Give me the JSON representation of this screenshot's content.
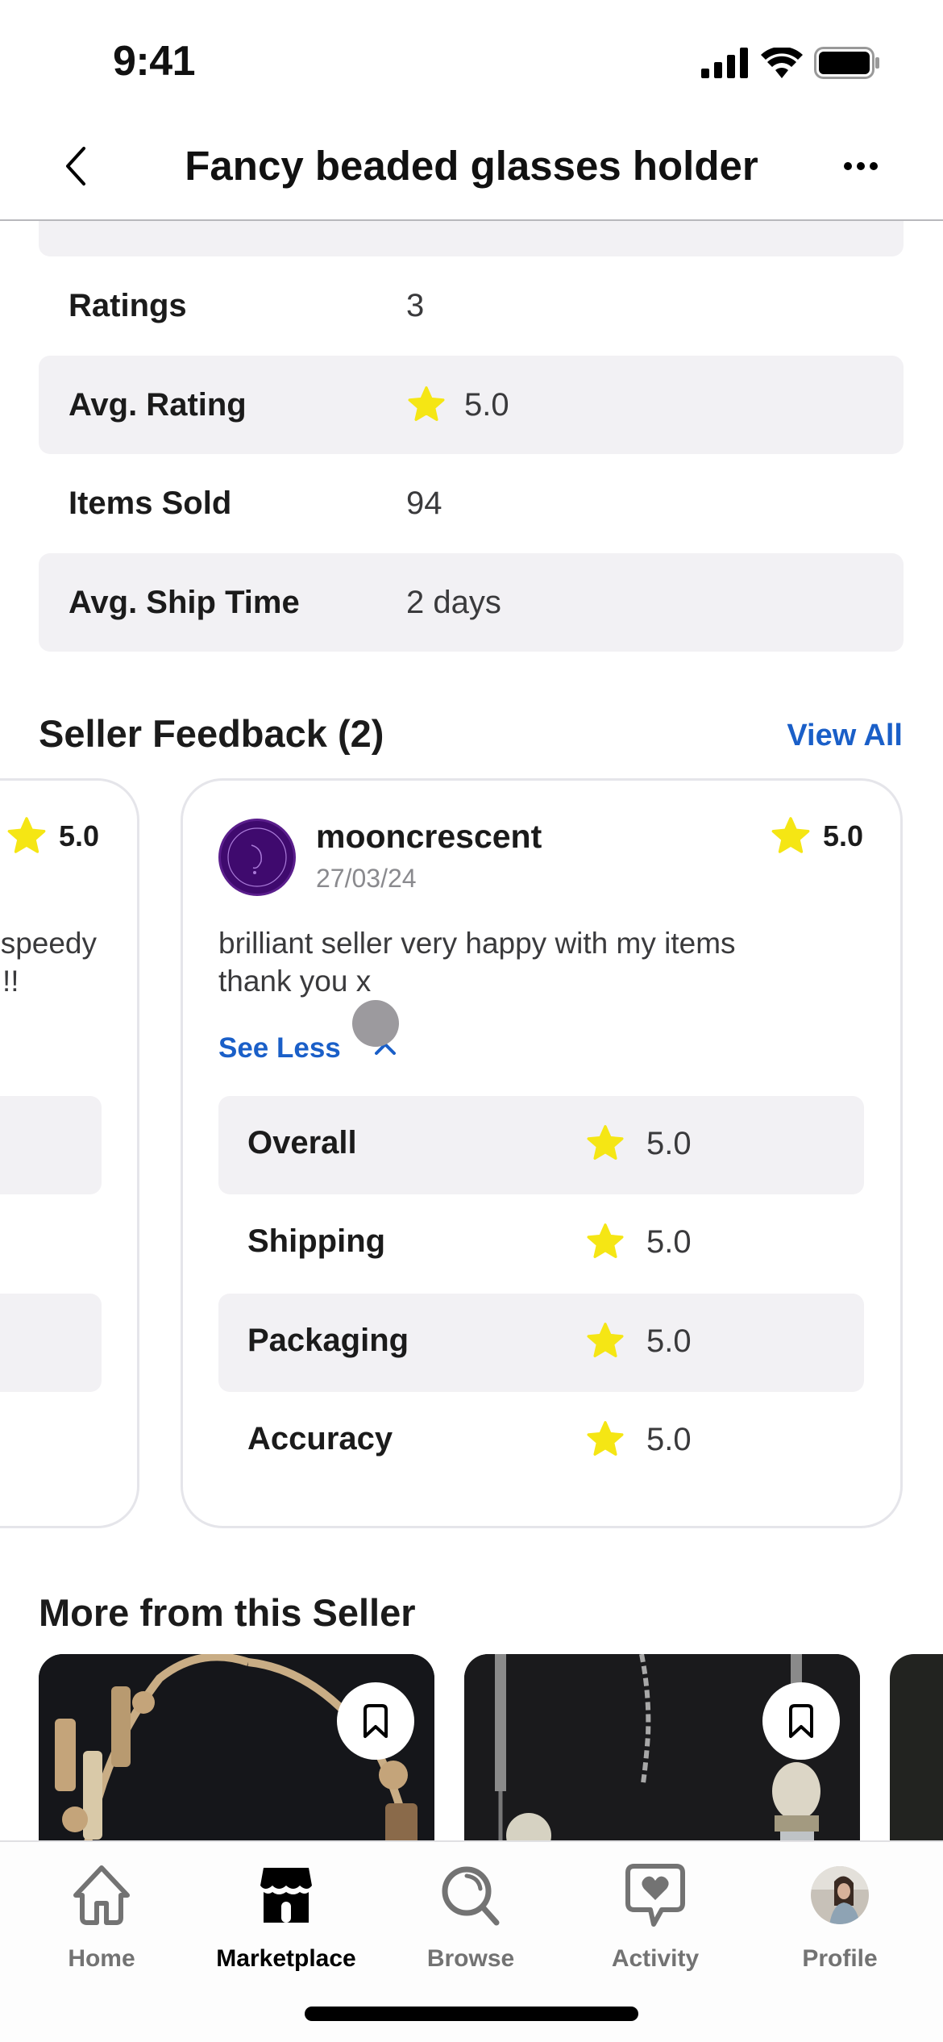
{
  "status_bar": {
    "time": "9:41"
  },
  "nav": {
    "title": "Fancy beaded glasses holder",
    "back_icon": "chevron-left-icon",
    "more_icon": "ellipsis-icon"
  },
  "stats": [
    {
      "label": "Ratings",
      "value": "3",
      "star": false
    },
    {
      "label": "Avg. Rating",
      "value": "5.0",
      "star": true
    },
    {
      "label": "Items Sold",
      "value": "94",
      "star": false
    },
    {
      "label": "Avg. Ship Time",
      "value": "2 days",
      "star": false
    }
  ],
  "feedback": {
    "title": "Seller Feedback (2)",
    "view_all": "View All",
    "previous_card": {
      "rating": "5.0",
      "text_line1": "speedy",
      "text_line2": "!!"
    },
    "card": {
      "username": "mooncrescent",
      "date": "27/03/24",
      "rating": "5.0",
      "text": "brilliant seller very happy with my items thank you x",
      "toggle": "See Less",
      "breakdown": [
        {
          "label": "Overall",
          "value": "5.0"
        },
        {
          "label": "Shipping",
          "value": "5.0"
        },
        {
          "label": "Packaging",
          "value": "5.0"
        },
        {
          "label": "Accuracy",
          "value": "5.0"
        }
      ]
    }
  },
  "more_from_seller": {
    "title": "More from this Seller"
  },
  "tabs": [
    {
      "label": "Home",
      "icon": "home-icon",
      "active": false
    },
    {
      "label": "Marketplace",
      "icon": "storefront-icon",
      "active": true
    },
    {
      "label": "Browse",
      "icon": "search-icon",
      "active": false
    },
    {
      "label": "Activity",
      "icon": "heart-message-icon",
      "active": false
    },
    {
      "label": "Profile",
      "icon": "profile-avatar",
      "active": false
    }
  ],
  "colors": {
    "accent": "#1a5fc8",
    "star": "#f5e614",
    "row_shade": "#f2f1f4",
    "avatar": "#3f0a6e"
  }
}
